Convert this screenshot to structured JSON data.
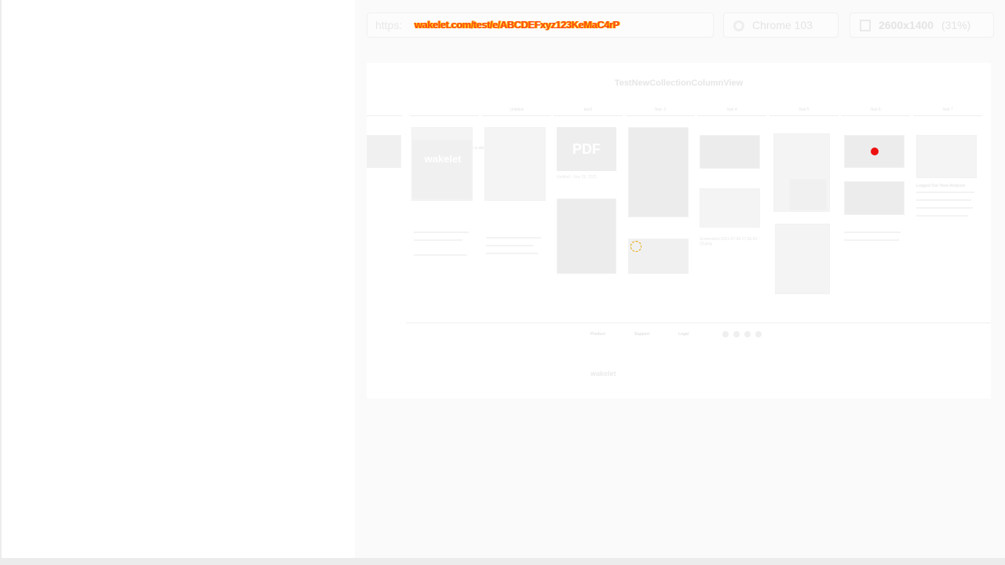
{
  "toolbar": {
    "url_prefix": "https:",
    "url_overlay": "wakelet.com/test/e/ABCDEFxyz123KeMaC4rP",
    "browser": "Chrome 103",
    "resolution": "2600x1400",
    "zoom": "(31%)"
  },
  "preview": {
    "collection_title": "TestNewCollectionColumnView",
    "columns": [
      "",
      "This article is about the...",
      "Untitled",
      "test2",
      "Test -2",
      "Test 4",
      "Test 5",
      "Test 6",
      "Test 7"
    ],
    "pdf_label": "PDF",
    "pdf_caption": "Untitled - Nov 29, 2021",
    "wakelet_tile": "wakelet",
    "screenshot_caption": "Screenshot 2021-07-09 17.56.53 (3).png",
    "logged_out": "Logged Out View Analysis",
    "footer": {
      "heads": [
        "Product",
        "Support",
        "Legal"
      ],
      "logo": "wakelet"
    }
  }
}
